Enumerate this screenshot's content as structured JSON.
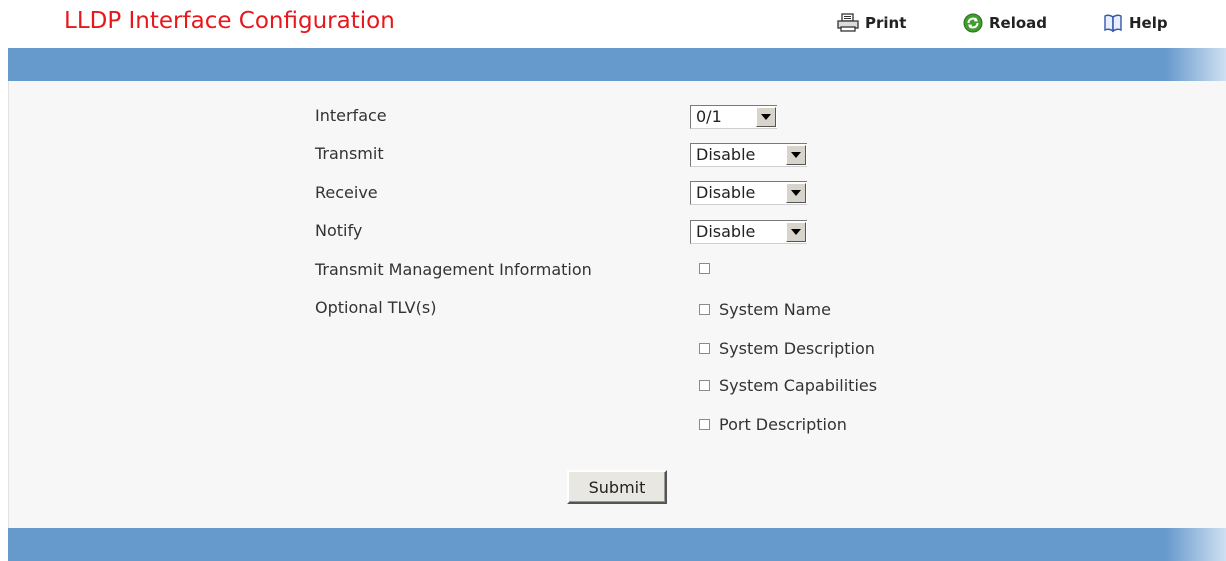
{
  "page": {
    "title": "LLDP Interface Configuration"
  },
  "toolbar": {
    "print": {
      "label": "Print",
      "icon": "printer-icon"
    },
    "reload": {
      "label": "Reload",
      "icon": "reload-icon"
    },
    "help": {
      "label": "Help",
      "icon": "book-icon"
    }
  },
  "colors": {
    "title": "#e8171c",
    "bar": "#6699cc",
    "panel": "#f7f7f7"
  },
  "form": {
    "interface": {
      "label": "Interface",
      "value": "0/1"
    },
    "transmit": {
      "label": "Transmit",
      "value": "Disable"
    },
    "receive": {
      "label": "Receive",
      "value": "Disable"
    },
    "notify": {
      "label": "Notify",
      "value": "Disable"
    },
    "mgmt": {
      "label": "Transmit Management Information",
      "checked": false
    },
    "tlv": {
      "label": "Optional TLV(s)",
      "options": [
        {
          "label": "System Name",
          "checked": false
        },
        {
          "label": "System Description",
          "checked": false
        },
        {
          "label": "System Capabilities",
          "checked": false
        },
        {
          "label": "Port Description",
          "checked": false
        }
      ]
    },
    "submit_label": "Submit"
  }
}
